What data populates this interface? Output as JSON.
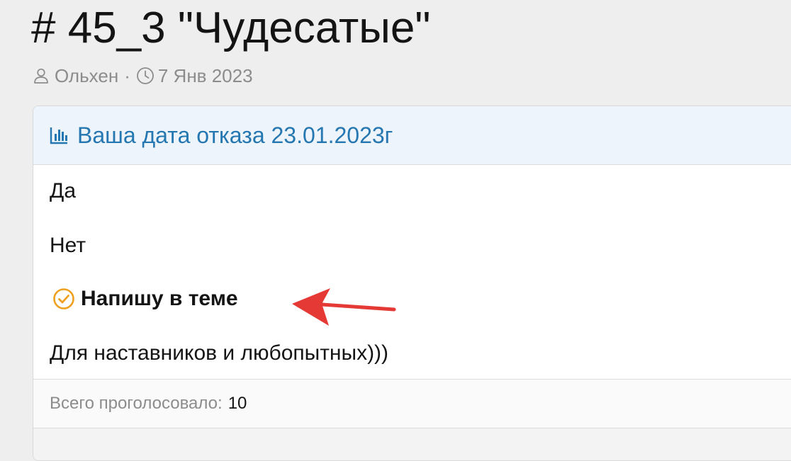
{
  "thread": {
    "title": "# 45_3 \"Чудесатые\"",
    "author": "Ольхен",
    "separator": "·",
    "date": "7 Янв 2023"
  },
  "poll": {
    "question": "Ваша дата отказа 23.01.2023г",
    "options": [
      {
        "label": "Да",
        "selected": false
      },
      {
        "label": "Нет",
        "selected": false
      },
      {
        "label": "Напишу в теме",
        "selected": true
      },
      {
        "label": "Для наставников и любопытных)))",
        "selected": false
      }
    ],
    "total_label": "Всего проголосовало:",
    "total_value": "10"
  },
  "icons": {
    "author": "user-icon",
    "date": "clock-icon",
    "poll": "bar-chart-icon",
    "selected": "check-circle-icon",
    "annotation": "red-arrow"
  },
  "colors": {
    "page_bg": "#eeeeee",
    "link": "#2577b1",
    "header_bg": "#edf4fb",
    "muted": "#8c8c8c",
    "check": "#f0a020",
    "arrow": "#e53935"
  }
}
